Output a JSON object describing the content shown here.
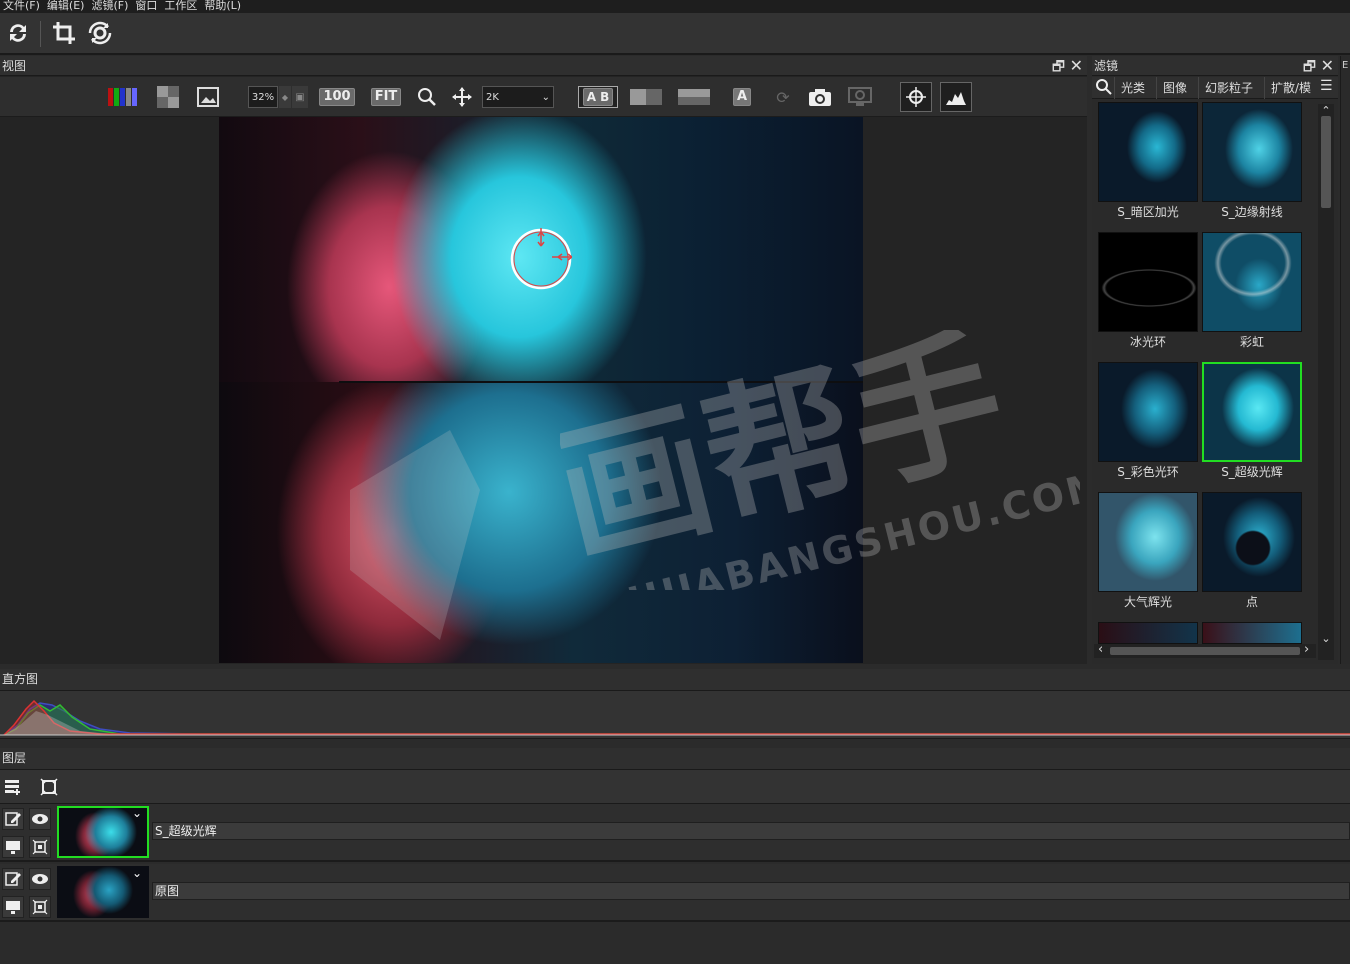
{
  "menu": [
    "文件(F)",
    "编辑(E)",
    "滤镜(F)",
    "窗口",
    "工作区",
    "帮助(L)"
  ],
  "toolbar": {
    "icons": [
      "refresh-icon",
      "crop-icon",
      "rotate-icon"
    ]
  },
  "view_panel": {
    "title": "视图",
    "zoom_value": "32%",
    "btn_100": "100",
    "btn_fit": "FIT",
    "resolution": "2K",
    "ab_label": "A B",
    "a_label": "A"
  },
  "filter_panel": {
    "title": "滤镜",
    "tabs": [
      "光类",
      "图像",
      "幻影粒子",
      "扩散/模"
    ],
    "items": [
      {
        "label": "S_暗区加光",
        "selected": false
      },
      {
        "label": "S_边缘射线",
        "selected": false
      },
      {
        "label": "冰光环",
        "selected": false
      },
      {
        "label": "彩虹",
        "selected": false
      },
      {
        "label": "S_彩色光环",
        "selected": false
      },
      {
        "label": "S_超级光辉",
        "selected": true
      },
      {
        "label": "大气辉光",
        "selected": false
      },
      {
        "label": "点",
        "selected": false
      }
    ]
  },
  "watermark": {
    "cn": "画帮手",
    "en": "HUABANGSHOU.COM"
  },
  "histogram": {
    "title": "直方图"
  },
  "layers_panel": {
    "title": "图层",
    "layers": [
      {
        "name": "S_超级光辉",
        "selected": true
      },
      {
        "name": "原图",
        "selected": false
      }
    ]
  },
  "right_edge_letter": "E",
  "colors": {
    "selection_green": "#22dd22",
    "panel_bg": "#2b2b2b"
  }
}
